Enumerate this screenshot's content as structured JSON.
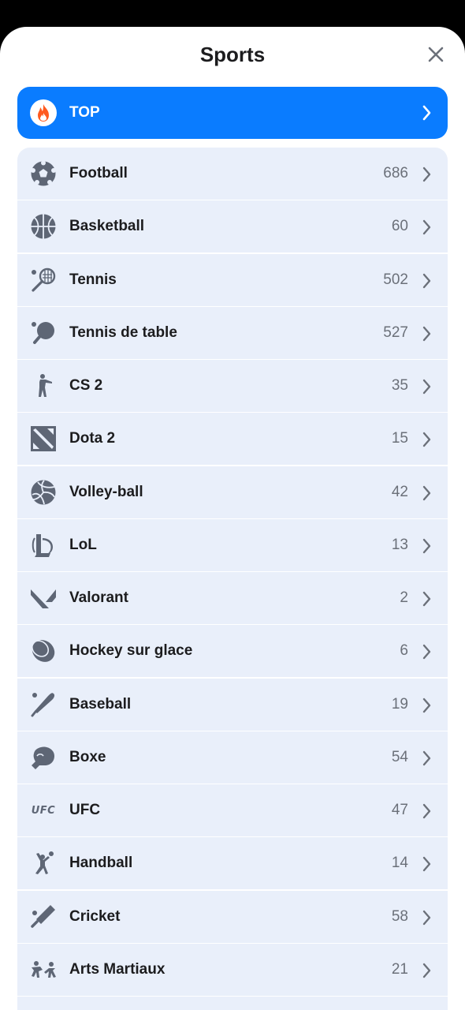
{
  "header": {
    "title": "Sports"
  },
  "top_item": {
    "label": "TOP"
  },
  "sports": [
    {
      "label": "Football",
      "count": "686",
      "icon": "football-icon"
    },
    {
      "label": "Basketball",
      "count": "60",
      "icon": "basketball-icon"
    },
    {
      "label": "Tennis",
      "count": "502",
      "icon": "tennis-icon"
    },
    {
      "label": "Tennis de table",
      "count": "527",
      "icon": "table-tennis-icon"
    },
    {
      "label": "CS 2",
      "count": "35",
      "icon": "cs2-icon"
    },
    {
      "label": "Dota 2",
      "count": "15",
      "icon": "dota2-icon"
    },
    {
      "label": "Volley-ball",
      "count": "42",
      "icon": "volleyball-icon"
    },
    {
      "label": "LoL",
      "count": "13",
      "icon": "lol-icon"
    },
    {
      "label": "Valorant",
      "count": "2",
      "icon": "valorant-icon"
    },
    {
      "label": "Hockey sur glace",
      "count": "6",
      "icon": "hockey-puck-icon"
    },
    {
      "label": "Baseball",
      "count": "19",
      "icon": "baseball-bat-icon"
    },
    {
      "label": "Boxe",
      "count": "54",
      "icon": "boxing-glove-icon"
    },
    {
      "label": "UFC",
      "count": "47",
      "icon": "ufc-icon",
      "icon_text": "UFC"
    },
    {
      "label": "Handball",
      "count": "14",
      "icon": "handball-icon"
    },
    {
      "label": "Cricket",
      "count": "58",
      "icon": "cricket-icon"
    },
    {
      "label": "Arts Martiaux",
      "count": "21",
      "icon": "martial-arts-icon"
    }
  ],
  "colors": {
    "accent": "#0a7cff",
    "row_bg": "#e9effa",
    "icon": "#5e6675",
    "fire": "#ff5a1f"
  }
}
